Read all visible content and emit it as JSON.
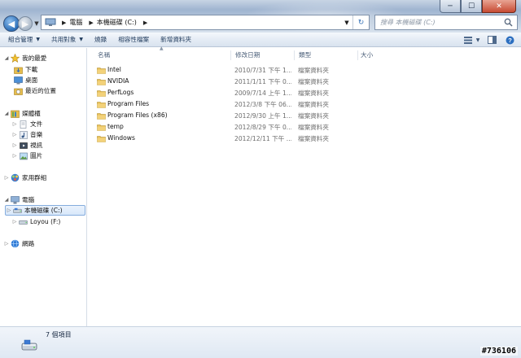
{
  "window": {
    "controls": {
      "minimize": "─",
      "maximize": "☐",
      "close": "✕"
    }
  },
  "address": {
    "segments": [
      "電腦",
      "本機磁碟 (C:)"
    ],
    "search_placeholder": "搜尋 本機磁碟 (C:)"
  },
  "toolbar": {
    "items": [
      "組合管理",
      "共用對象",
      "燒錄",
      "相容性檔案",
      "新增資料夾"
    ]
  },
  "sidebar": {
    "favorites": "我的最愛",
    "fav_items": [
      "下載",
      "桌面",
      "最近的位置"
    ],
    "libraries": "媒體櫃",
    "lib_items": [
      "文件",
      "音樂",
      "視訊",
      "圖片"
    ],
    "homegroup": "家用群組",
    "computer": "電腦",
    "drives": [
      "本機磁碟 (C:)",
      "Loyou (F:)"
    ],
    "network": "網路"
  },
  "columns": {
    "name": "名稱",
    "date": "修改日期",
    "type": "類型",
    "size": "大小"
  },
  "files": [
    {
      "name": "Intel",
      "date": "2010/7/31 下午 1...",
      "type": "檔案資料夾"
    },
    {
      "name": "NVIDIA",
      "date": "2011/1/11 下午 0...",
      "type": "檔案資料夾"
    },
    {
      "name": "PerfLogs",
      "date": "2009/7/14 上午 1...",
      "type": "檔案資料夾"
    },
    {
      "name": "Program Files",
      "date": "2012/3/8 下午 06...",
      "type": "檔案資料夾"
    },
    {
      "name": "Program Files (x86)",
      "date": "2012/9/30 上午 1...",
      "type": "檔案資料夾"
    },
    {
      "name": "temp",
      "date": "2012/8/29 下午 0...",
      "type": "檔案資料夾"
    },
    {
      "name": "Windows",
      "date": "2012/12/11 下午 ...",
      "type": "檔案資料夾"
    }
  ],
  "status": {
    "item_count": "7 個項目"
  },
  "watermark": "#736106",
  "colors": {
    "accent": "#3672b8",
    "selection": "#d8e8fa"
  }
}
